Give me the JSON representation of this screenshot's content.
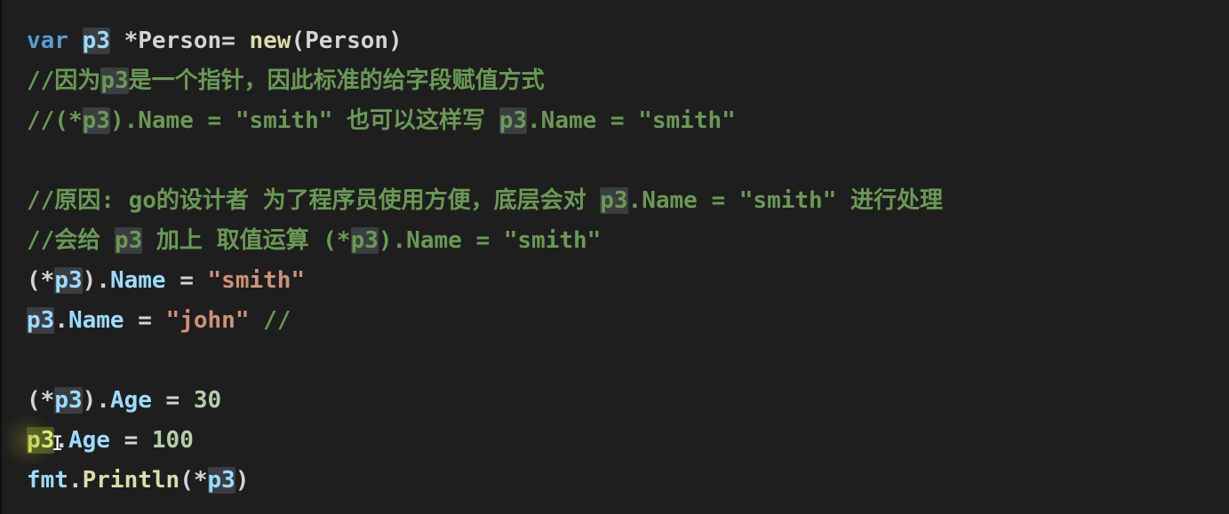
{
  "editor": {
    "lines": [
      [
        {
          "t": "var",
          "c": "kw"
        },
        {
          "t": " "
        },
        {
          "t": "p3",
          "c": "var hl"
        },
        {
          "t": " *Person= "
        },
        {
          "t": "new",
          "c": "fn"
        },
        {
          "t": "(Person)"
        }
      ],
      [
        {
          "t": "//因为",
          "c": "cm"
        },
        {
          "t": "p3",
          "c": "cm hl"
        },
        {
          "t": "是一个指针，因此标准的给字段赋值方式",
          "c": "cm"
        }
      ],
      [
        {
          "t": "//(*",
          "c": "cm"
        },
        {
          "t": "p3",
          "c": "cm hl"
        },
        {
          "t": ").Name = \"smith\" 也可以这样写 ",
          "c": "cm"
        },
        {
          "t": "p3",
          "c": "cm hl"
        },
        {
          "t": ".Name = \"smith\"",
          "c": "cm"
        }
      ],
      [],
      [
        {
          "t": "//原因: go的设计者 为了程序员使用方便，底层会对 ",
          "c": "cm"
        },
        {
          "t": "p3",
          "c": "cm hl"
        },
        {
          "t": ".Name = \"smith\" 进行处理",
          "c": "cm"
        }
      ],
      [
        {
          "t": "//会给 ",
          "c": "cm"
        },
        {
          "t": "p3",
          "c": "cm hl"
        },
        {
          "t": " 加上 取值运算 (*",
          "c": "cm"
        },
        {
          "t": "p3",
          "c": "cm hl"
        },
        {
          "t": ").Name = \"smith\"",
          "c": "cm"
        }
      ],
      [
        {
          "t": "(*"
        },
        {
          "t": "p3",
          "c": "var hl"
        },
        {
          "t": ")."
        },
        {
          "t": "Name",
          "c": "prop"
        },
        {
          "t": " = "
        },
        {
          "t": "\"smith\"",
          "c": "str"
        }
      ],
      [
        {
          "t": "p3",
          "c": "var hl"
        },
        {
          "t": "."
        },
        {
          "t": "Name",
          "c": "prop"
        },
        {
          "t": " = "
        },
        {
          "t": "\"john\"",
          "c": "str"
        },
        {
          "t": " //",
          "c": "cm"
        }
      ],
      [],
      [
        {
          "t": "(*"
        },
        {
          "t": "p3",
          "c": "var hl"
        },
        {
          "t": ")."
        },
        {
          "t": "Age",
          "c": "prop"
        },
        {
          "t": " = "
        },
        {
          "t": "30",
          "c": "num"
        }
      ],
      [
        {
          "t": "p3",
          "c": "hl-cur"
        },
        {
          "t": "."
        },
        {
          "t": "Age",
          "c": "prop"
        },
        {
          "t": " = "
        },
        {
          "t": "100",
          "c": "num"
        }
      ],
      [
        {
          "t": "fmt",
          "c": "var"
        },
        {
          "t": "."
        },
        {
          "t": "Println",
          "c": "fn"
        },
        {
          "t": "(*"
        },
        {
          "t": "p3",
          "c": "var hl"
        },
        {
          "t": ")"
        }
      ]
    ]
  },
  "mouse_cursor": {
    "glyph": "I",
    "icon": "text-ibeam-cursor-icon"
  }
}
